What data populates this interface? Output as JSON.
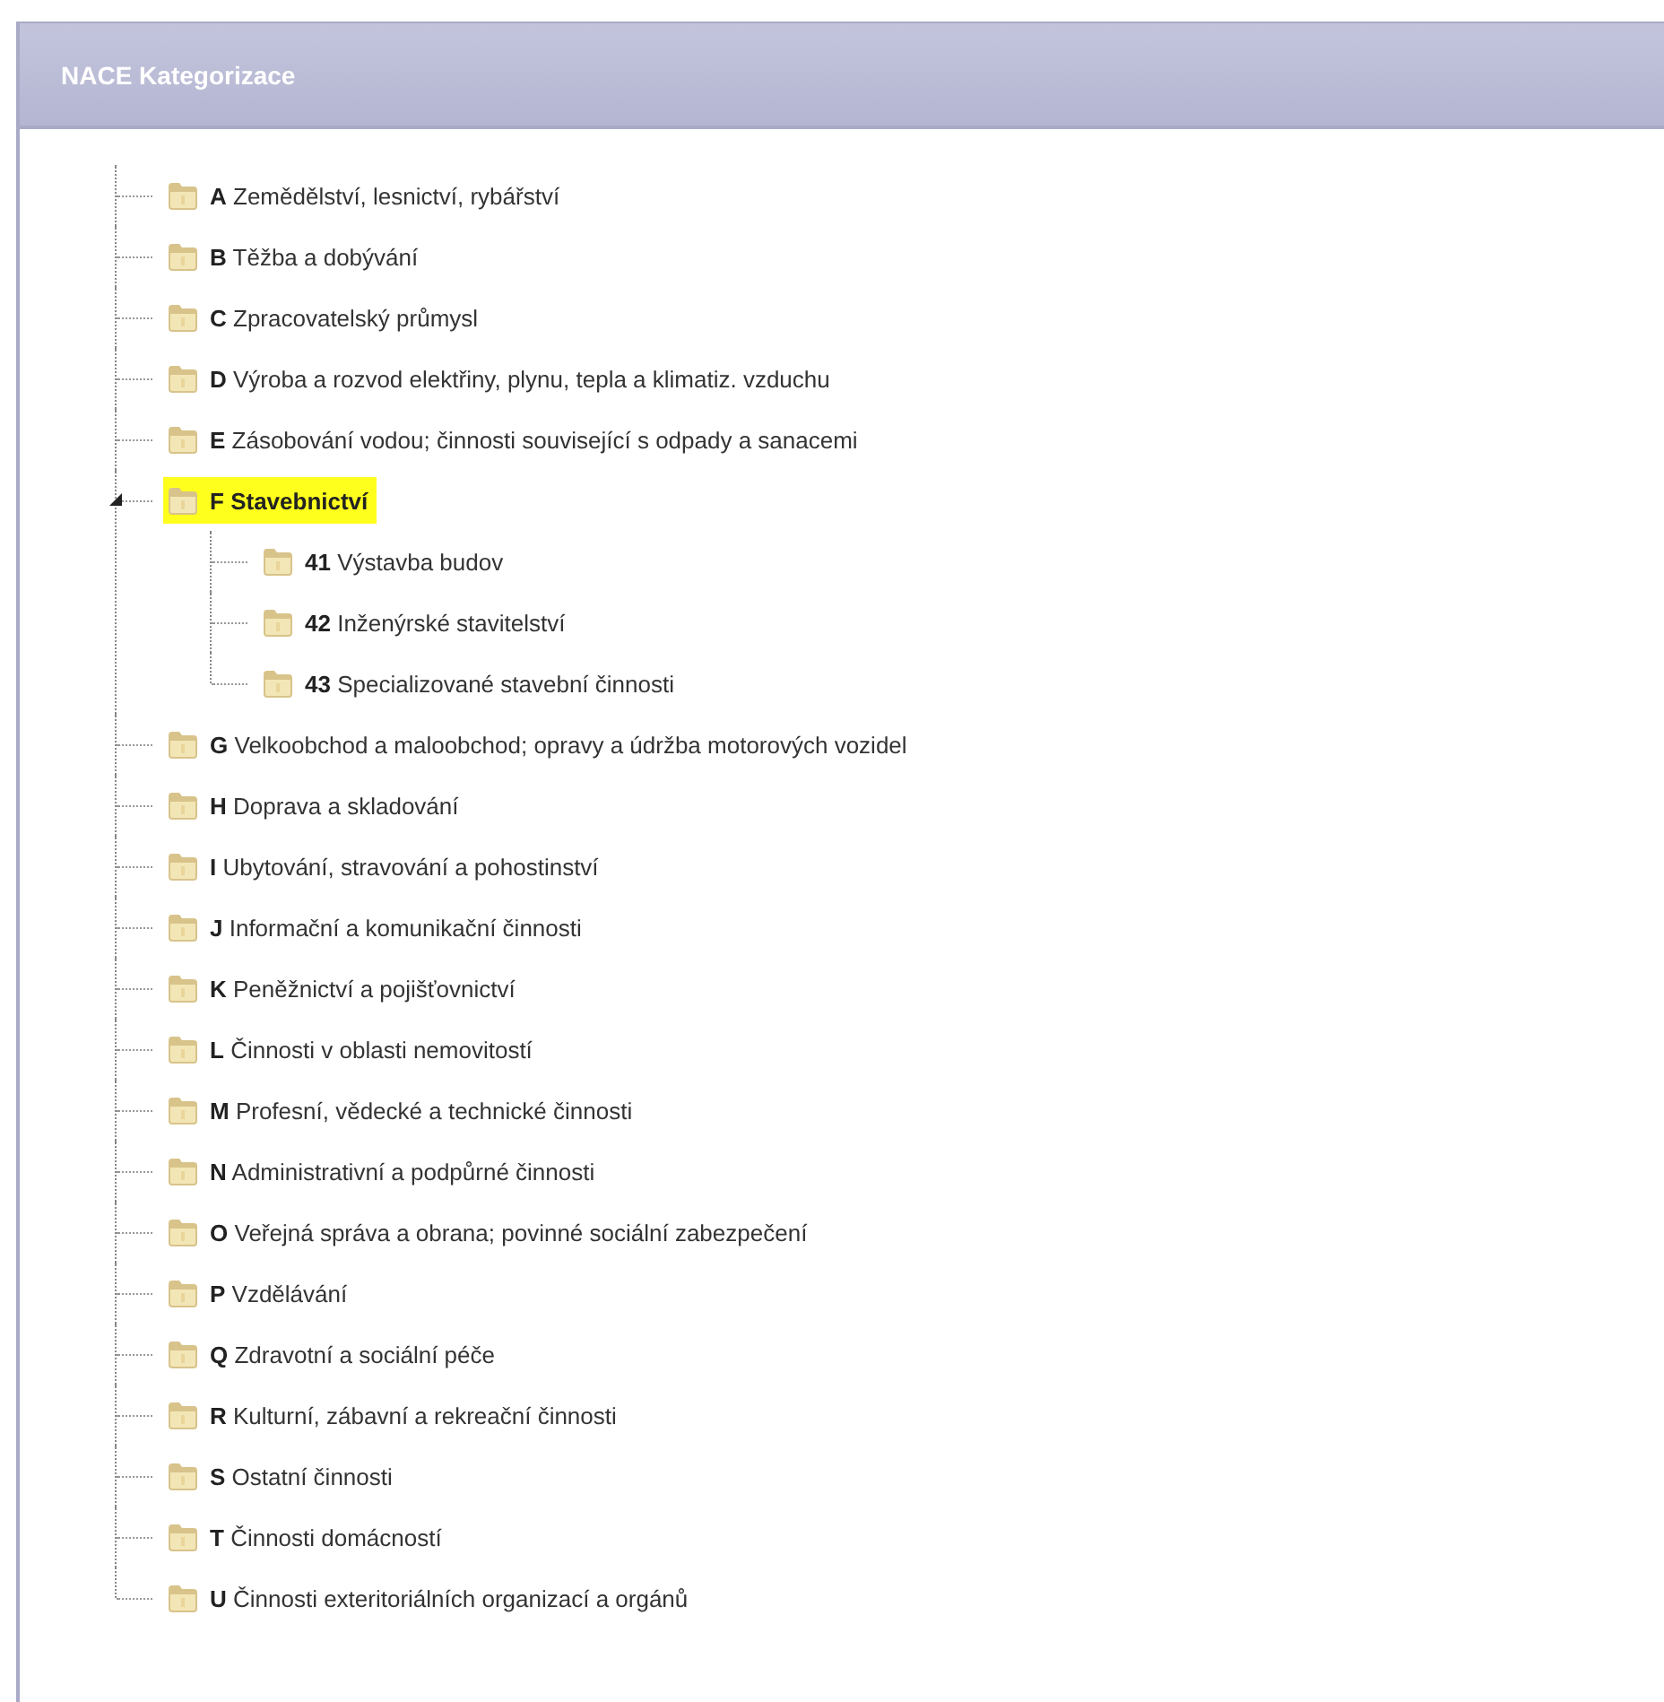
{
  "panel": {
    "title": "NACE Kategorizace"
  },
  "tree": [
    {
      "code": "A",
      "name": "Zemědělství, lesnictví, rybářství",
      "selected": false
    },
    {
      "code": "B",
      "name": "Těžba a dobývání",
      "selected": false
    },
    {
      "code": "C",
      "name": "Zpracovatelský průmysl",
      "selected": false
    },
    {
      "code": "D",
      "name": "Výroba a rozvod elektřiny, plynu, tepla a klimatiz. vzduchu",
      "selected": false
    },
    {
      "code": "E",
      "name": "Zásobování vodou; činnosti související s odpady a sanacemi",
      "selected": false
    },
    {
      "code": "F",
      "name": "Stavebnictví",
      "selected": true,
      "expanded": true,
      "children": [
        {
          "code": "41",
          "name": "Výstavba budov",
          "selected": false
        },
        {
          "code": "42",
          "name": "Inženýrské stavitelství",
          "selected": false
        },
        {
          "code": "43",
          "name": "Specializované stavební činnosti",
          "selected": false
        }
      ]
    },
    {
      "code": "G",
      "name": "Velkoobchod a maloobchod; opravy a údržba motorových vozidel",
      "selected": false
    },
    {
      "code": "H",
      "name": "Doprava a skladování",
      "selected": false
    },
    {
      "code": "I",
      "name": "Ubytování, stravování a pohostinství",
      "selected": false
    },
    {
      "code": "J",
      "name": "Informační a komunikační činnosti",
      "selected": false
    },
    {
      "code": "K",
      "name": "Peněžnictví a pojišťovnictví",
      "selected": false
    },
    {
      "code": "L",
      "name": "Činnosti v oblasti nemovitostí",
      "selected": false
    },
    {
      "code": "M",
      "name": "Profesní, vědecké a technické činnosti",
      "selected": false
    },
    {
      "code": "N",
      "name": "Administrativní a podpůrné činnosti",
      "selected": false
    },
    {
      "code": "O",
      "name": "Veřejná správa a obrana; povinné sociální zabezpečení",
      "selected": false
    },
    {
      "code": "P",
      "name": "Vzdělávání",
      "selected": false
    },
    {
      "code": "Q",
      "name": "Zdravotní a sociální péče",
      "selected": false
    },
    {
      "code": "R",
      "name": "Kulturní, zábavní a rekreační činnosti",
      "selected": false
    },
    {
      "code": "S",
      "name": "Ostatní činnosti",
      "selected": false
    },
    {
      "code": "T",
      "name": "Činnosti domácností",
      "selected": false
    },
    {
      "code": "U",
      "name": "Činnosti exteritoriálních organizací a orgánů",
      "selected": false
    }
  ]
}
